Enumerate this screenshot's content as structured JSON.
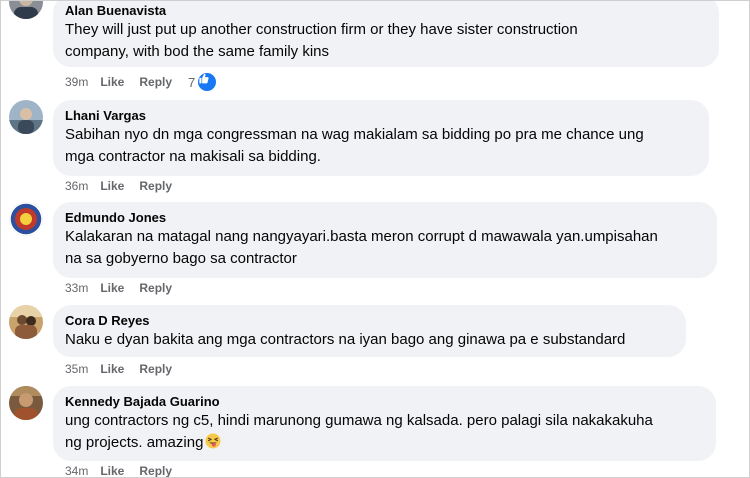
{
  "comments": [
    {
      "author": "Alan Buenavista",
      "text_lines": [
        "They will just put up another construction firm or they have sister construction",
        "company, with bod the same family kins"
      ],
      "time": "39m",
      "like_label": "Like",
      "reply_label": "Reply",
      "reaction_count": "7",
      "reaction_icon": "like-reaction-icon"
    },
    {
      "author": "Lhani Vargas",
      "text_lines": [
        "Sabihan nyo dn mga congressman na wag makialam sa bidding po pra me chance ung",
        "mga contractor na makisali sa bidding."
      ],
      "time": "36m",
      "like_label": "Like",
      "reply_label": "Reply"
    },
    {
      "author": "Edmundo Jones",
      "text_lines": [
        "Kalakaran na matagal nang nangyayari.basta meron corrupt d mawawala yan.umpisahan",
        "na sa gobyerno bago sa contractor"
      ],
      "time": "33m",
      "like_label": "Like",
      "reply_label": "Reply"
    },
    {
      "author": "Cora D Reyes",
      "text_lines": [
        "Naku e dyan bakita ang mga contractors na iyan bago ang ginawa pa e substandard"
      ],
      "time": "35m",
      "like_label": "Like",
      "reply_label": "Reply"
    },
    {
      "author": "Kennedy Bajada Guarino",
      "text_lines": [
        "ung contractors ng c5, hindi marunong gumawa ng kalsada. pero palagi sila nakakakuha",
        "ng projects. amazing"
      ],
      "emoji": "squinting-tongue-emoji",
      "time": "34m",
      "like_label": "Like",
      "reply_label": "Reply"
    }
  ],
  "colors": {
    "bubble": "#f0f2f5",
    "text": "#050505",
    "meta": "#65676b",
    "like_blue": "#1877f2"
  }
}
